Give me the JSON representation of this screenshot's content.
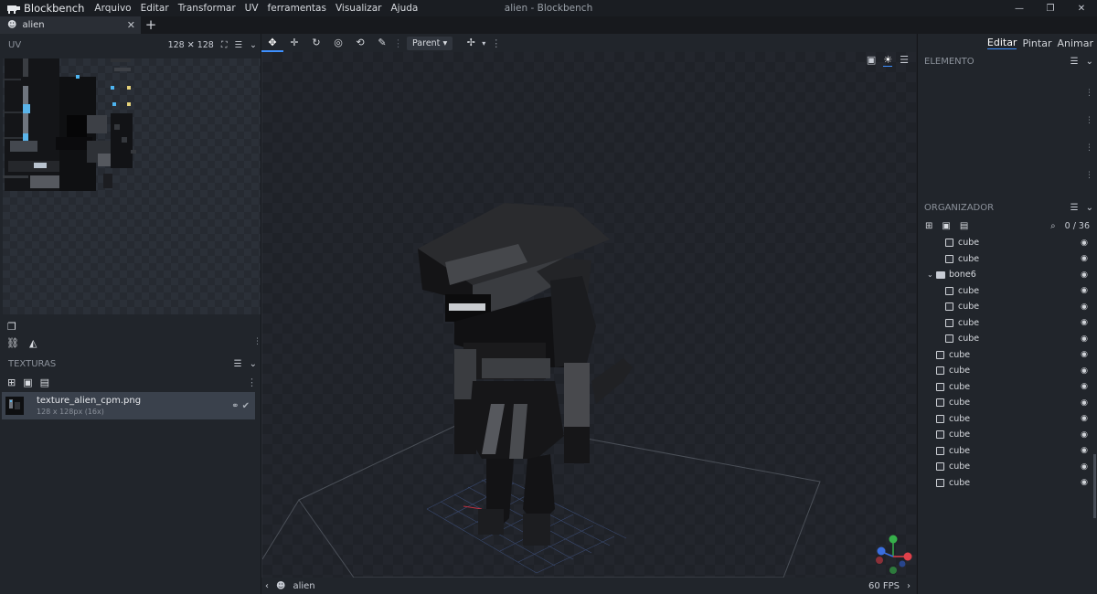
{
  "app": {
    "name": "Blockbench",
    "window_title": "alien - Blockbench",
    "menu": [
      "Arquivo",
      "Editar",
      "Transformar",
      "UV",
      "ferramentas",
      "Visualizar",
      "Ajuda"
    ]
  },
  "tab": {
    "label": "alien"
  },
  "uv_panel": {
    "title": "UV",
    "size_label": "128 ✕ 128"
  },
  "textures_panel": {
    "title": "TEXTURAS",
    "item": {
      "name": "texture_alien_cpm.png",
      "meta": "128 x 128px (16x)"
    }
  },
  "viewport": {
    "transform_space": "Parent",
    "model_name": "alien",
    "fps": "60 FPS"
  },
  "modes": [
    "Editar",
    "Pintar",
    "Animar"
  ],
  "active_mode": "Editar",
  "element_panel": {
    "title": "ELEMENTO"
  },
  "outliner": {
    "title": "ORGANIZADOR",
    "counter": "0 / 36",
    "rows": [
      {
        "label": "cube",
        "indent": 2,
        "type": "cube"
      },
      {
        "label": "cube",
        "indent": 2,
        "type": "cube"
      },
      {
        "label": "bone6",
        "indent": 1,
        "type": "group"
      },
      {
        "label": "cube",
        "indent": 2,
        "type": "cube"
      },
      {
        "label": "cube",
        "indent": 2,
        "type": "cube"
      },
      {
        "label": "cube",
        "indent": 2,
        "type": "cube"
      },
      {
        "label": "cube",
        "indent": 2,
        "type": "cube"
      },
      {
        "label": "cube",
        "indent": 1,
        "type": "cube"
      },
      {
        "label": "cube",
        "indent": 1,
        "type": "cube"
      },
      {
        "label": "cube",
        "indent": 1,
        "type": "cube"
      },
      {
        "label": "cube",
        "indent": 1,
        "type": "cube"
      },
      {
        "label": "cube",
        "indent": 1,
        "type": "cube"
      },
      {
        "label": "cube",
        "indent": 1,
        "type": "cube"
      },
      {
        "label": "cube",
        "indent": 1,
        "type": "cube"
      },
      {
        "label": "cube",
        "indent": 1,
        "type": "cube"
      },
      {
        "label": "cube",
        "indent": 1,
        "type": "cube"
      }
    ]
  },
  "colors": {
    "accent": "#3e90ff",
    "background": "#21252b",
    "viewport": "#1f2228"
  }
}
